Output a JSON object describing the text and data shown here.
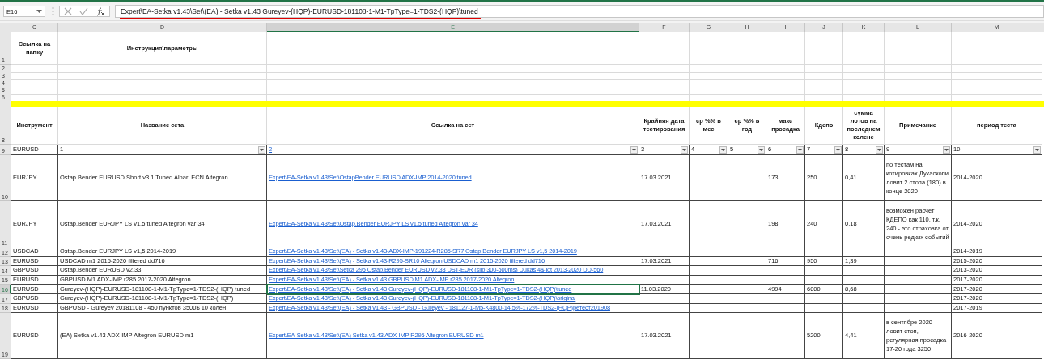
{
  "name_box": {
    "value": "E16"
  },
  "formula_bar": {
    "value": "Expert\\EA-Setka v1.43\\Set\\(EA) - Setka v1.43 Gureyev-(HQP)-EURUSD-181108-1-M1-TpType=1-TDS2-(HQP)\\tuned"
  },
  "columns": [
    {
      "letter": "C",
      "selected": false
    },
    {
      "letter": "D",
      "selected": false
    },
    {
      "letter": "E",
      "selected": true
    },
    {
      "letter": "F",
      "selected": false
    },
    {
      "letter": "G",
      "selected": false
    },
    {
      "letter": "H",
      "selected": false
    },
    {
      "letter": "I",
      "selected": false
    },
    {
      "letter": "J",
      "selected": false
    },
    {
      "letter": "K",
      "selected": false
    },
    {
      "letter": "L",
      "selected": false
    },
    {
      "letter": "M",
      "selected": false
    }
  ],
  "rows": [
    {
      "number": "1",
      "kind": "label",
      "selected": false,
      "cells": [
        "Ссылка на папку",
        "Инструкция\\параметры"
      ]
    },
    {
      "number": "2",
      "kind": "empty",
      "selected": false
    },
    {
      "number": "3",
      "kind": "empty",
      "selected": false
    },
    {
      "number": "4",
      "kind": "empty",
      "selected": false
    },
    {
      "number": "5",
      "kind": "empty",
      "selected": false
    },
    {
      "number": "6",
      "kind": "empty",
      "selected": false
    },
    {
      "kind": "band",
      "color": "#ffff00"
    },
    {
      "number": "8",
      "kind": "header",
      "selected": false,
      "cells": [
        "Инструмент",
        "Название сета",
        "Ссылка на сет",
        "Крайняя дата тестирования",
        "ср %% в мес",
        "ср %% в год",
        "макс просадка",
        "Кдепо",
        "сумма лотов на последнем колене",
        "Примечание",
        "период теста"
      ]
    },
    {
      "number": "9",
      "kind": "filter",
      "selected": false,
      "cells": [
        {
          "text": "EURUSD",
          "filter": false,
          "link": false
        },
        {
          "text": "1",
          "filter": true,
          "link": false
        },
        {
          "text": "2",
          "filter": true,
          "link": true
        },
        {
          "text": "3",
          "filter": true,
          "link": false
        },
        {
          "text": "4",
          "filter": true,
          "link": false
        },
        {
          "text": "5",
          "filter": true,
          "link": false
        },
        {
          "text": "6",
          "filter": true,
          "link": false
        },
        {
          "text": "7",
          "filter": true,
          "link": false
        },
        {
          "text": "8",
          "filter": true,
          "link": false
        },
        {
          "text": "9",
          "filter": true,
          "link": false
        },
        {
          "text": "10",
          "filter": true,
          "link": false
        }
      ]
    },
    {
      "number": "10",
      "kind": "data_tall",
      "selected": false,
      "instrument": "EURJPY",
      "set_name": "Ostap.Bender EURUSD Short v3.1 Tuned Alpari ECN Altegron",
      "set_link": "Expert\\EA-Setka v1.43\\Set\\OstapBender EURUSD ADX-IMP 2014-2020 tuned",
      "test_date": "17.03.2021",
      "max_drawdown": "173",
      "kdepo": "250",
      "lots_sum": "0,41",
      "note": "по тестам на котировках Дукаскопи ловит 2 стопа (180) в конце 2020",
      "test_period": "2014-2020"
    },
    {
      "number": "11",
      "kind": "data_tall",
      "selected": false,
      "instrument": "EURJPY",
      "set_name": "Ostap.Bender EURJPY LS v1,5 tuned Altegron var 34",
      "set_link": "Expert\\EA-Setka v1.43\\Set\\Ostap.Bender EURJPY LS v1,5 tuned Altegron var 34",
      "test_date": "17.03.2021",
      "max_drawdown": "198",
      "kdepo": "240",
      "lots_sum": "0,18",
      "note": "возможен расчет КДЕПО как 110, т.к. 240 - это страховка от очень редких событий",
      "test_period": "2014-2020"
    },
    {
      "number": "12",
      "kind": "data",
      "selected": false,
      "instrument": "USDCAD",
      "set_name": "Ostap.Bender EURJPY LS v1,5 2014-2019",
      "set_link": "Expert\\EA-Setka v1.43\\Set\\(EA) - Setka v1.43-ADX-IMP-191224-R285-SR7 Ostap.Bender EURJPY LS v1,5 2014-2019",
      "test_period": "2014-2019"
    },
    {
      "number": "13",
      "kind": "data",
      "selected": false,
      "instrument": "EURUSD",
      "set_name": "USDCAD m1 2015-2020 filtered dd716",
      "set_link": "Expert\\EA-Setka v1.43\\Set\\(EA) - Setka v1.43-R295-SR10 Altegron USDCAD m1 2015-2020 filtered dd716",
      "test_date": "17.03.2021",
      "max_drawdown": "716",
      "kdepo": "950",
      "lots_sum": "1,39",
      "test_period": "2015-2020"
    },
    {
      "number": "14",
      "kind": "data",
      "selected": false,
      "instrument": "GBPUSD",
      "set_name": "Ostap.Bender EURUSD  v2,33",
      "set_link": "Expert\\EA-Setka v1.43\\Set\\Setka 295 Ostap.Bender EURUSD v2.33 DST-EUR (slip 300-500ms) Dukas 4$-lot 2013-2020 DD-560",
      "test_period": "2013-2020"
    },
    {
      "number": "15",
      "kind": "data",
      "selected": false,
      "instrument": "EURUSD",
      "set_name": "GBPUSD M1 ADX-IMP r285 2017-2020 Altegron",
      "set_link": "Expert\\EA-Setka v1.43\\Set\\(EA) - Setka v1.43 GBPUSD M1 ADX-IMP r285 2017-2020 Altegron",
      "test_period": "2017-2020"
    },
    {
      "number": "16",
      "kind": "data",
      "selected": true,
      "instrument": "EURUSD",
      "set_name": "Gureyev-(HQP)-EURUSD-181108-1-M1-TpType=1-TDS2-(HQP) tuned",
      "set_link": "Expert\\EA-Setka v1.43\\Set\\(EA) - Setka v1.43 Gureyev-(HQP)-EURUSD-181108-1-M1-TpType=1-TDS2-(HQP)\\tuned",
      "test_date": "11.03.2020",
      "max_drawdown": "4994",
      "kdepo": "6000",
      "lots_sum": "8,68",
      "test_period": "2017-2020"
    },
    {
      "number": "17",
      "kind": "data",
      "selected": false,
      "instrument": "GBPUSD",
      "set_name": "Gureyev-(HQP)-EURUSD-181108-1-M1-TpType=1-TDS2-(HQP)",
      "set_link": "Expert\\EA-Setka v1.43\\Set\\(EA) - Setka v1.43 Gureyev-(HQP)-EURUSD-181108-1-M1-TpType=1-TDS2-(HQP)\\original",
      "test_period": "2017-2020"
    },
    {
      "number": "18",
      "kind": "data",
      "selected": false,
      "instrument": "EURUSD",
      "set_name": "GBPUSD - Gureyev 20181108 - 450 пунктов 3500$ 10 колен",
      "set_link": "Expert\\EA-Setka v1.43\\Set\\(EA) - Setka v1.43 - GBPUSD - Gureyev - 181127-1-M5-K4800-14.5%-172%-TDS2-(HQP)ретест201908",
      "test_period": "2017-2019"
    },
    {
      "number": "19",
      "kind": "data_tall",
      "selected": false,
      "instrument": "EURUSD",
      "set_name": "(EA) Setka v1.43 ADX-IMP Altegron EURUSD m1",
      "set_link": "Expert\\EA-Setka v1.43\\Set\\(EA) Setka v1.43 ADX-IMP R295 Altegron EURUSD m1",
      "test_date": "17.03.2021",
      "kdepo": "5200",
      "lots_sum": "4,41",
      "note": "в сентябре 2020 ловит стоп, регулярная просадка 17-20 года 3250",
      "test_period": "2016-2020"
    }
  ]
}
